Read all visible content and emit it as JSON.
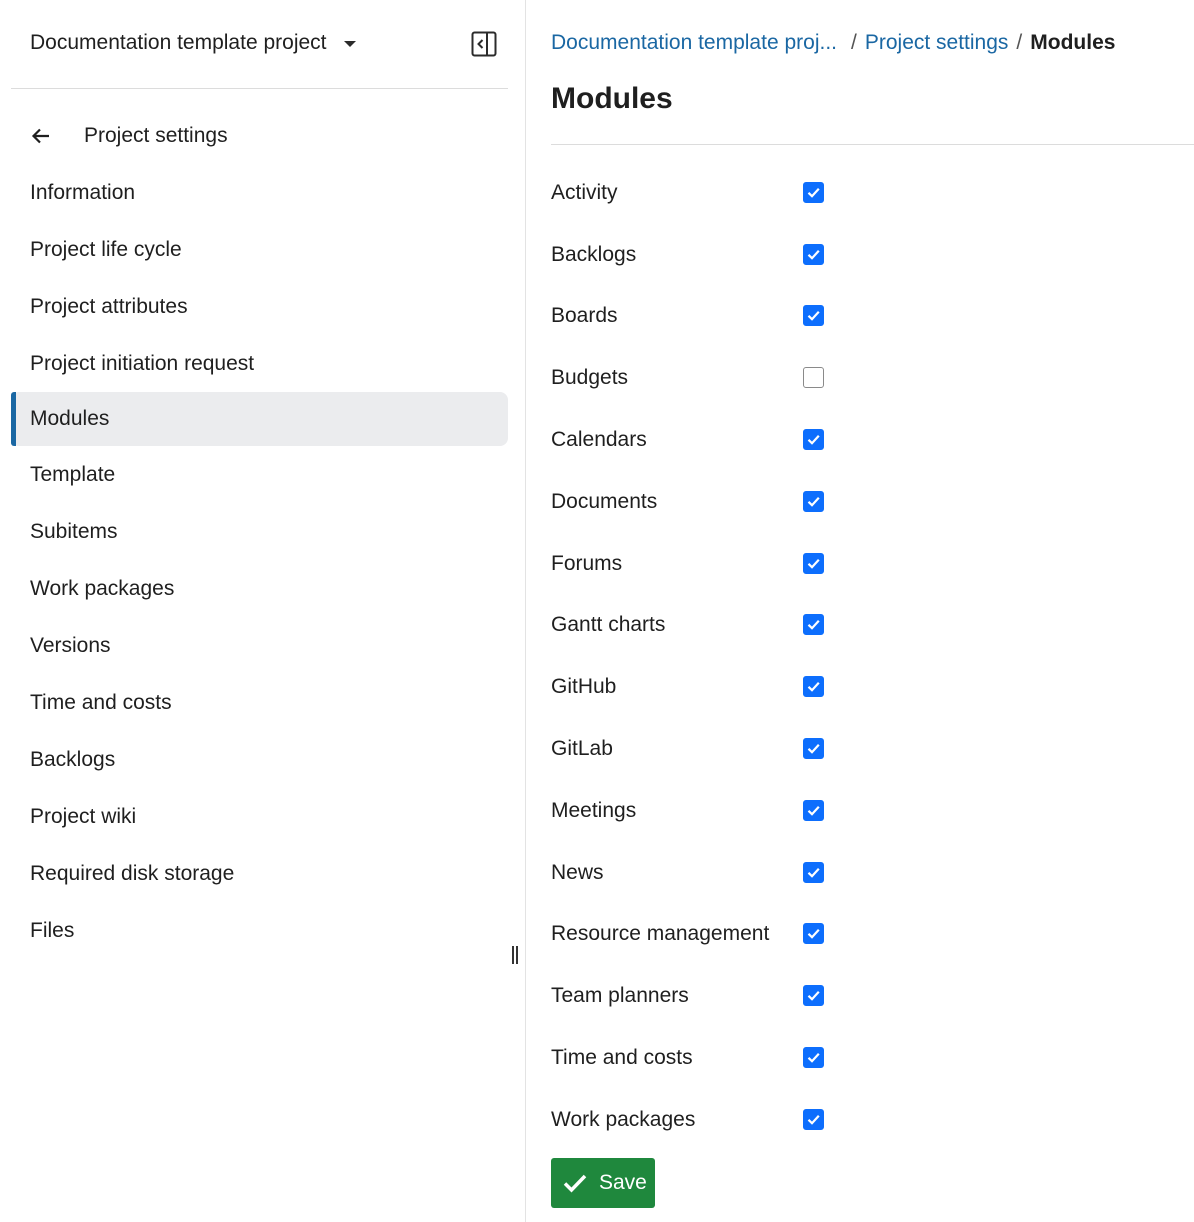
{
  "sidebar": {
    "project_name": "Documentation template project",
    "back_label": "Project settings",
    "items": [
      {
        "label": "Information",
        "active": false
      },
      {
        "label": "Project life cycle",
        "active": false
      },
      {
        "label": "Project attributes",
        "active": false
      },
      {
        "label": "Project initiation request",
        "active": false
      },
      {
        "label": "Modules",
        "active": true
      },
      {
        "label": "Template",
        "active": false
      },
      {
        "label": "Subitems",
        "active": false
      },
      {
        "label": "Work packages",
        "active": false
      },
      {
        "label": "Versions",
        "active": false
      },
      {
        "label": "Time and costs",
        "active": false
      },
      {
        "label": "Backlogs",
        "active": false
      },
      {
        "label": "Project wiki",
        "active": false
      },
      {
        "label": "Required disk storage",
        "active": false
      },
      {
        "label": "Files",
        "active": false
      }
    ]
  },
  "breadcrumb": {
    "project": "Documentation template proj...",
    "settings": "Project settings",
    "current": "Modules"
  },
  "page": {
    "title": "Modules"
  },
  "modules": [
    {
      "label": "Activity",
      "checked": true
    },
    {
      "label": "Backlogs",
      "checked": true
    },
    {
      "label": "Boards",
      "checked": true
    },
    {
      "label": "Budgets",
      "checked": false
    },
    {
      "label": "Calendars",
      "checked": true
    },
    {
      "label": "Documents",
      "checked": true
    },
    {
      "label": "Forums",
      "checked": true
    },
    {
      "label": "Gantt charts",
      "checked": true
    },
    {
      "label": "GitHub",
      "checked": true
    },
    {
      "label": "GitLab",
      "checked": true
    },
    {
      "label": "Meetings",
      "checked": true
    },
    {
      "label": "News",
      "checked": true
    },
    {
      "label": "Resource management",
      "checked": true
    },
    {
      "label": "Team planners",
      "checked": true
    },
    {
      "label": "Time and costs",
      "checked": true
    },
    {
      "label": "Work packages",
      "checked": true
    }
  ],
  "actions": {
    "save_label": "Save"
  },
  "colors": {
    "accent": "#1a67a3",
    "checkbox": "#0d6efd",
    "save": "#1f883d",
    "active_bg": "#ebecee"
  }
}
